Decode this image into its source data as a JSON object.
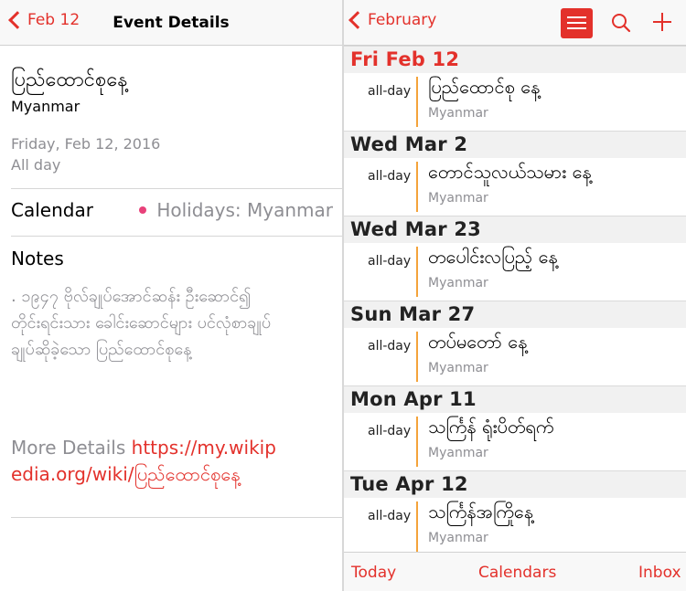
{
  "left": {
    "back_label": "Feb 12",
    "nav_title": "Event Details",
    "event_title": "ပြည်ထောင်စုနေ့",
    "location": "Myanmar",
    "date": "Friday, Feb 12, 2016",
    "all_day": "All day",
    "calendar_label": "Calendar",
    "calendar_value": "Holidays: Myanmar",
    "calendar_dot_color": "#e8417a",
    "notes_label": "Notes",
    "notes_text": ". ၁၉၄၇ ဗိုလ်ချုပ်အောင်ဆန်း ဦးဆောင်၍ တိုင်းရင်းသား ခေါင်းဆောင်များ ပင်လုံစာချုပ် ချုပ်ဆိုခဲ့သော ပြည်ထောင်စုနေ့",
    "more_details_label": "More Details",
    "more_details_link": "https://my.wikipedia.org/wiki/ပြည်ထောင်စုနေ့"
  },
  "right": {
    "back_label": "February",
    "list_icon": "list-icon",
    "search_icon": "search-icon",
    "add_icon": "plus-icon",
    "days": [
      {
        "header": "Fri  Feb 12",
        "today": true,
        "allday": "all-day",
        "title": "ပြည်ထောင်စု နေ့",
        "location": "Myanmar"
      },
      {
        "header": "Wed  Mar 2",
        "today": false,
        "allday": "all-day",
        "title": "တောင်သူလယ်သမား နေ့",
        "location": "Myanmar"
      },
      {
        "header": "Wed  Mar 23",
        "today": false,
        "allday": "all-day",
        "title": "တပေါင်းလပြည့် နေ့",
        "location": "Myanmar"
      },
      {
        "header": "Sun  Mar 27",
        "today": false,
        "allday": "all-day",
        "title": "တပ်မတော် နေ့",
        "location": "Myanmar"
      },
      {
        "header": "Mon  Apr 11",
        "today": false,
        "allday": "all-day",
        "title": "သင်္ကြန် ရုံးပိတ်ရက်",
        "location": "Myanmar"
      },
      {
        "header": "Tue  Apr 12",
        "today": false,
        "allday": "all-day",
        "title": "သင်္ကြန်အကြိုနေ့",
        "location": "Myanmar"
      }
    ],
    "tabs": {
      "today": "Today",
      "calendars": "Calendars",
      "inbox": "Inbox"
    }
  },
  "colors": {
    "accent": "#e3312b",
    "event_bar": "#f4a33a",
    "secondary_text": "#8e8e93"
  }
}
